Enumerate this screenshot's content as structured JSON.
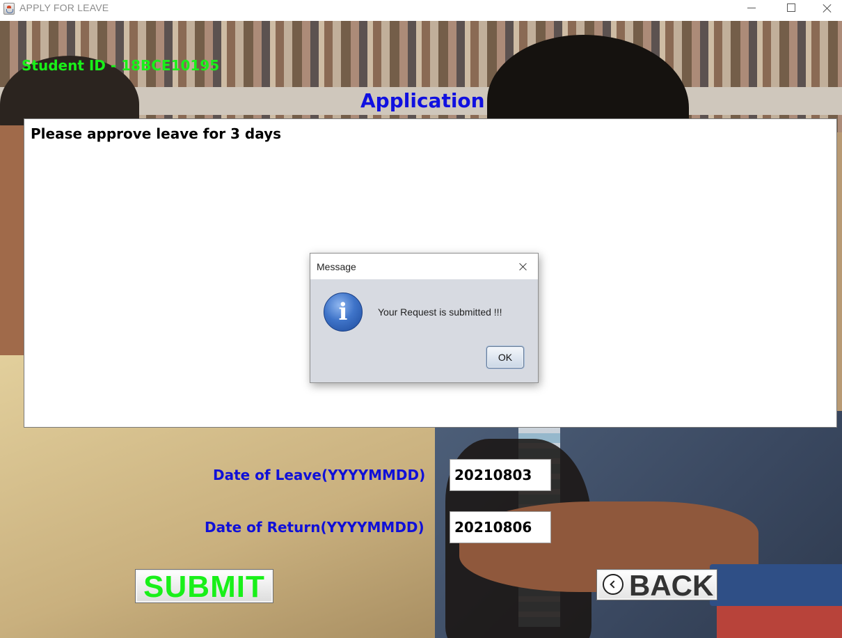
{
  "window": {
    "title": "APPLY FOR LEAVE",
    "icon": "java-app-icon"
  },
  "form": {
    "student_id_label": "Student ID - 18BCE10195",
    "application_heading": "Application",
    "application_text": "Please approve leave for 3 days",
    "date_of_leave_label": "Date of Leave(YYYYMMDD)",
    "date_of_leave_value": "20210803",
    "date_of_return_label": "Date of Return(YYYYMMDD)",
    "date_of_return_value": "20210806",
    "submit_label": "SUBMIT",
    "back_label": "BACK"
  },
  "dialog": {
    "title": "Message",
    "message": "Your Request is submitted !!!",
    "ok_label": "OK",
    "icon": "info-icon"
  },
  "colors": {
    "student_id": "#19f019",
    "heading": "#1010e0",
    "field_labels": "#1010d8",
    "submit_text": "#19f019",
    "dialog_bg": "#d7dae1"
  }
}
